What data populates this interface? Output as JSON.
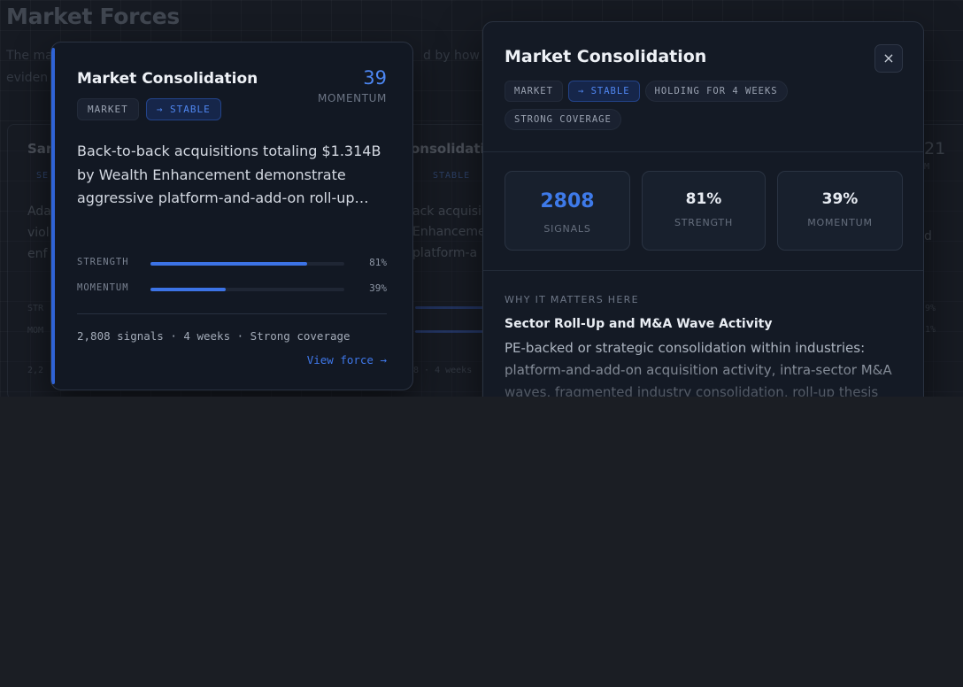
{
  "background": {
    "page_title": "Market Forces",
    "subtitle_left": "The ma",
    "subtitle_right": "d by how m",
    "subtitle_line2": "eviden",
    "card_left": {
      "title_fragment": "Sar",
      "chip_fragment": "SE",
      "text_lines": [
        "Ada",
        "viol",
        "enf"
      ],
      "meta_lines": [
        "STR",
        "MOM"
      ],
      "footer_fragment": "2,2"
    },
    "card_middle": {
      "title_fragment": "onsolidatio",
      "chip_fragment": "STABLE",
      "text_lines": [
        "ack acquisi",
        "Enhanceme",
        "platform-a"
      ],
      "footer_fragment": "8 · 4 weeks"
    },
    "card_right": {
      "score_fragment": "21",
      "label_fragment": "M",
      "text_fragment": "d",
      "pct_lines": [
        "9%",
        "1%"
      ]
    }
  },
  "hover_card": {
    "title": "Market Consolidation",
    "score": "39",
    "score_label": "MOMENTUM",
    "chips": [
      {
        "label": "MARKET",
        "style": "default"
      },
      {
        "label": "→ STABLE",
        "style": "accent"
      }
    ],
    "description": "Back-to-back acquisitions totaling $1.314B by Wealth Enhancement demonstrate aggressive platform-and-add-on roll-up…",
    "metrics": [
      {
        "label": "STRENGTH",
        "value": "81%",
        "fill": 0.81
      },
      {
        "label": "MOMENTUM",
        "value": "39%",
        "fill": 0.39
      }
    ],
    "footer": "2,808 signals · 4 weeks · Strong coverage",
    "link": "View force →"
  },
  "panel": {
    "title": "Market Consolidation",
    "close_glyph": "×",
    "chips": [
      {
        "label": "MARKET",
        "style": "default"
      },
      {
        "label": "→ STABLE",
        "style": "accent"
      },
      {
        "label": "HOLDING FOR 4 WEEKS",
        "style": "pill"
      },
      {
        "label": "STRONG COVERAGE",
        "style": "pill"
      }
    ],
    "stats": [
      {
        "value": "2808",
        "label": "SIGNALS"
      },
      {
        "value": "81%",
        "label": "STRENGTH"
      },
      {
        "value": "39%",
        "label": "MOMENTUM"
      }
    ],
    "section_label": "WHY IT MATTERS HERE",
    "section_heading": "Sector Roll-Up and M&A Wave Activity",
    "section_body": "PE-backed or strategic consolidation within industries: platform-and-add-on acquisition activity, intra-sector M&A waves, fragmented industry consolidation, roll-up thesis"
  },
  "colors": {
    "accent": "#3e7ae9",
    "page_bg": "#161a22",
    "card_bg": "#121823",
    "panel_bg": "#141a25"
  }
}
